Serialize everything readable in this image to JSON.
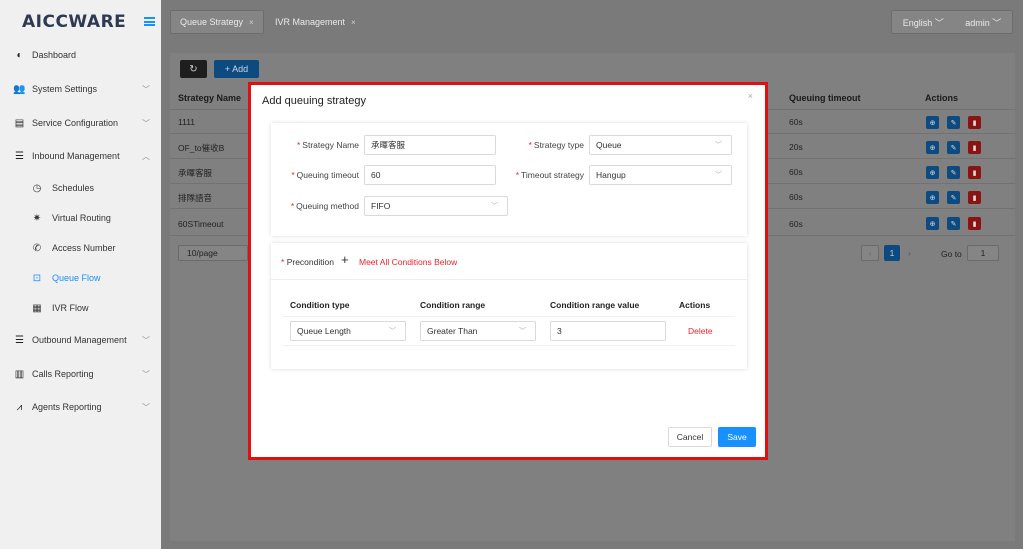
{
  "brand": {
    "logo": "AICCWARE"
  },
  "sidebar": {
    "items": [
      {
        "label": "Dashboard"
      },
      {
        "label": "System Settings"
      },
      {
        "label": "Service Configuration"
      },
      {
        "label": "Inbound Management"
      },
      {
        "label": "Schedules"
      },
      {
        "label": "Virtual Routing"
      },
      {
        "label": "Access Number"
      },
      {
        "label": "Queue Flow"
      },
      {
        "label": "IVR Flow"
      },
      {
        "label": "Outbound Management"
      },
      {
        "label": "Calls Reporting"
      },
      {
        "label": "Agents Reporting"
      }
    ]
  },
  "tabs": [
    {
      "label": "Queue Strategy"
    },
    {
      "label": "IVR Management"
    }
  ],
  "header": {
    "language": "English",
    "user": "admin"
  },
  "toolbar": {
    "add_label": "+ Add"
  },
  "table": {
    "columns": {
      "name": "Strategy Name",
      "timeout": "Queuing timeout",
      "actions": "Actions"
    },
    "rows": [
      {
        "name": "1111",
        "timeout": "60s"
      },
      {
        "name": "OF_to催收B",
        "timeout": "20s"
      },
      {
        "name": "承暉客服",
        "timeout": "60s"
      },
      {
        "name": "排隊語音",
        "timeout": "60s"
      },
      {
        "name": "60STimeout",
        "timeout": "60s"
      }
    ]
  },
  "pagination": {
    "page_size": "10/page",
    "current": "1",
    "goto_label": "Go to",
    "goto_value": "1"
  },
  "modal": {
    "title": "Add queuing strategy",
    "close": "×",
    "fields": {
      "strategy_name_label": "Strategy Name",
      "strategy_name_value": "承暉客服",
      "strategy_type_label": "Strategy type",
      "strategy_type_value": "Queue",
      "queuing_timeout_label": "Queuing timeout",
      "queuing_timeout_value": "60",
      "timeout_strategy_label": "Timeout strategy",
      "timeout_strategy_value": "Hangup",
      "queuing_method_label": "Queuing method",
      "queuing_method_value": "FIFO"
    },
    "precondition": {
      "label": "Precondition",
      "link": "Meet All Conditions Below",
      "columns": {
        "type": "Condition type",
        "range": "Condition range",
        "value": "Condition range value",
        "actions": "Actions"
      },
      "row": {
        "type": "Queue Length",
        "range": "Greater Than",
        "value": "3",
        "delete": "Delete"
      }
    },
    "cancel": "Cancel",
    "save": "Save"
  },
  "colors": {
    "primary": "#1890ff",
    "danger": "#f5222d",
    "highlight_border": "#e01010"
  }
}
